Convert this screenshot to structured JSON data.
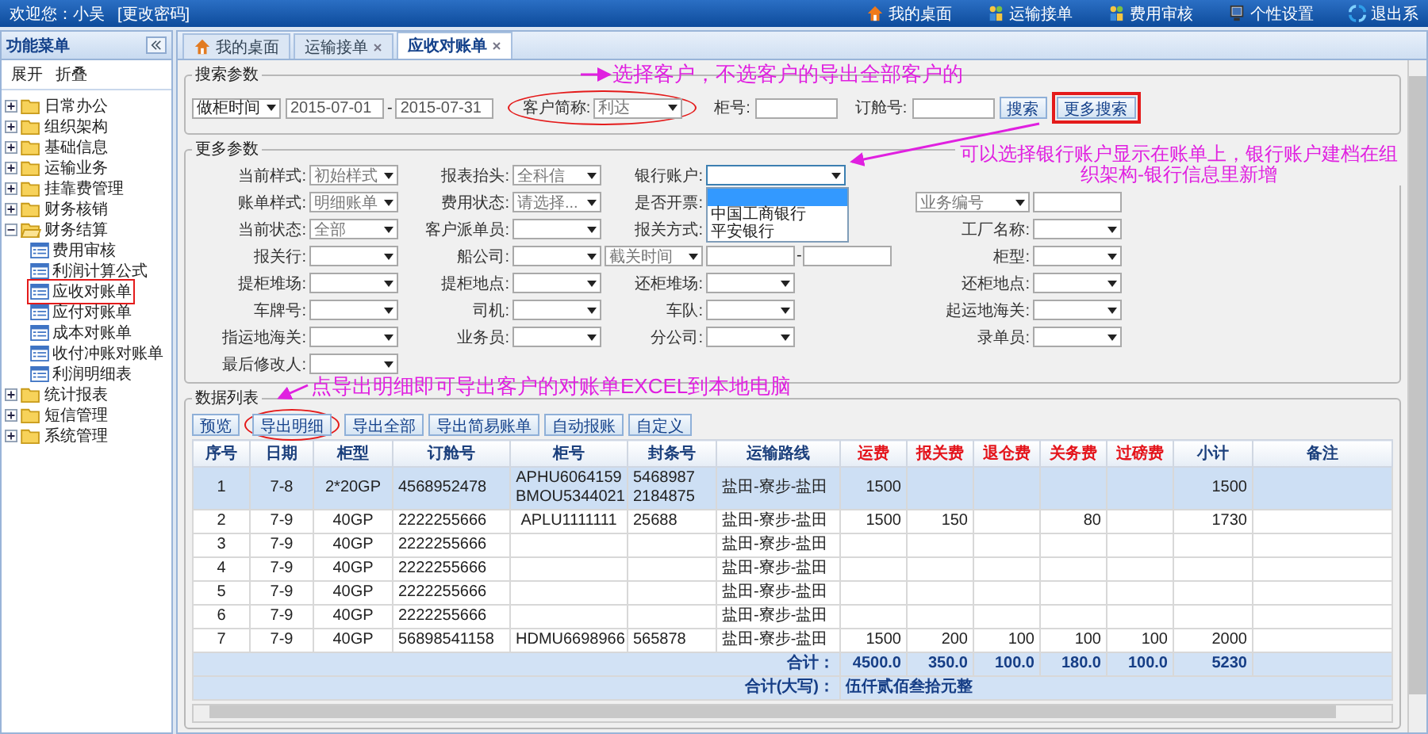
{
  "top_bar": {
    "welcome": "欢迎您：小吴",
    "change_password": "[更改密码]",
    "links": [
      {
        "kind": "home",
        "label": "我的桌面"
      },
      {
        "kind": "people",
        "label": "运输接单"
      },
      {
        "kind": "people",
        "label": "费用审核"
      },
      {
        "kind": "monitor",
        "label": "个性设置"
      },
      {
        "kind": "exit",
        "label": "退出系"
      }
    ]
  },
  "sidebar": {
    "title": "功能菜单",
    "actions": [
      "展开",
      "折叠"
    ],
    "tree": [
      {
        "label": "日常办公",
        "expanded": false
      },
      {
        "label": "组织架构",
        "expanded": false
      },
      {
        "label": "基础信息",
        "expanded": false
      },
      {
        "label": "运输业务",
        "expanded": false
      },
      {
        "label": "挂靠费管理",
        "expanded": false
      },
      {
        "label": "财务核销",
        "expanded": false
      },
      {
        "label": "财务结算",
        "expanded": true,
        "children": [
          {
            "label": "费用审核",
            "circled": false
          },
          {
            "label": "利润计算公式",
            "circled": false
          },
          {
            "label": "应收对账单",
            "circled": true
          },
          {
            "label": "应付对账单",
            "circled": false
          },
          {
            "label": "成本对账单",
            "circled": false
          },
          {
            "label": "收付冲账对账单",
            "circled": false
          },
          {
            "label": "利润明细表",
            "circled": false
          }
        ]
      },
      {
        "label": "统计报表",
        "expanded": false
      },
      {
        "label": "短信管理",
        "expanded": false
      },
      {
        "label": "系统管理",
        "expanded": false
      }
    ]
  },
  "tabs": [
    {
      "label": "我的桌面",
      "kind": "home",
      "closable": false,
      "selected": false
    },
    {
      "label": "运输接单",
      "kind": "plain",
      "closable": true,
      "selected": false
    },
    {
      "label": "应收对账单",
      "kind": "plain",
      "closable": true,
      "selected": true
    }
  ],
  "search": {
    "legend": "搜索参数",
    "date_type": "做柜时间",
    "date_from": "2015-07-01",
    "separator": "-",
    "date_to": "2015-07-31",
    "customer": {
      "label": "客户简称:",
      "value": "利达",
      "circled": true
    },
    "container_label": "柜号:",
    "booking_label": "订舱号:",
    "buttons": [
      {
        "label": "搜索",
        "circled": false
      },
      {
        "label": "更多搜索",
        "circled": true
      }
    ]
  },
  "more": {
    "legend": "更多参数",
    "rows": [
      [
        {
          "kind": "select",
          "label": "当前样式:",
          "value": "初始样式"
        },
        {
          "kind": "select",
          "label": "报表抬头:",
          "value": "全科信"
        },
        {
          "kind": "select_open",
          "label": "银行账户:",
          "options": [
            {
              "selected": true
            },
            {
              "label": "中国工商银行",
              "selected": false
            },
            {
              "label": "平安银行",
              "selected": false
            }
          ]
        }
      ],
      [
        {
          "kind": "select",
          "label": "账单样式:",
          "value": "明细账单"
        },
        {
          "kind": "select",
          "label": "费用状态:",
          "value": "请选择..."
        },
        {
          "kind": "covered",
          "label": "是否开票:"
        },
        {
          "kind": "select_input",
          "value": "业务编号"
        }
      ],
      [
        {
          "kind": "select",
          "label": "当前状态:",
          "value": "全部"
        },
        {
          "kind": "select",
          "label": "客户派单员:"
        },
        {
          "kind": "covered",
          "label": "报关方式:"
        },
        {
          "kind": "select",
          "label": "工厂名称:"
        }
      ],
      [
        {
          "kind": "select",
          "label": "报关行:"
        },
        {
          "kind": "select",
          "label": "船公司:"
        },
        {
          "kind": "select_range",
          "value": "截关时间",
          "separator": "-"
        },
        {
          "kind": "select",
          "label": "柜型:"
        }
      ],
      [
        {
          "kind": "select",
          "label": "提柜堆场:"
        },
        {
          "kind": "select",
          "label": "提柜地点:"
        },
        {
          "kind": "select",
          "label": "还柜堆场:"
        },
        {
          "kind": "select",
          "label": "还柜地点:"
        }
      ],
      [
        {
          "kind": "select",
          "label": "车牌号:"
        },
        {
          "kind": "select",
          "label": "司机:"
        },
        {
          "kind": "select",
          "label": "车队:"
        },
        {
          "kind": "select",
          "label": "起运地海关:"
        }
      ],
      [
        {
          "kind": "select",
          "label": "指运地海关:"
        },
        {
          "kind": "select",
          "label": "业务员:"
        },
        {
          "kind": "select",
          "label": "分公司:"
        },
        {
          "kind": "select",
          "label": "录单员:"
        }
      ],
      [
        {
          "kind": "select",
          "label": "最后修改人:"
        }
      ]
    ]
  },
  "data_list": {
    "legend": "数据列表",
    "toolbar": [
      {
        "label": "预览",
        "circled": false
      },
      {
        "label": "导出明细",
        "circled": true
      },
      {
        "label": "导出全部",
        "circled": false
      },
      {
        "label": "导出简易账单",
        "circled": false
      },
      {
        "label": "自动报账",
        "circled": false
      },
      {
        "label": "自定义",
        "circled": false
      }
    ],
    "columns": [
      {
        "label": "序号",
        "kind": "plain"
      },
      {
        "label": "日期",
        "kind": "plain"
      },
      {
        "label": "柜型",
        "kind": "plain"
      },
      {
        "label": "订舱号",
        "kind": "plain"
      },
      {
        "label": "柜号",
        "kind": "plain"
      },
      {
        "label": "封条号",
        "kind": "plain"
      },
      {
        "label": "运输路线",
        "kind": "plain"
      },
      {
        "label": "运费",
        "kind": "fee"
      },
      {
        "label": "报关费",
        "kind": "fee"
      },
      {
        "label": "退仓费",
        "kind": "fee"
      },
      {
        "label": "关务费",
        "kind": "fee"
      },
      {
        "label": "过磅费",
        "kind": "fee"
      },
      {
        "label": "小计",
        "kind": "plain"
      },
      {
        "label": "备注",
        "kind": "plain"
      }
    ],
    "rows": [
      {
        "selected": true,
        "cells": [
          "1",
          "7-8",
          "2*20GP",
          "4568952478",
          "APHU6064159\nBMOU5344021",
          "5468987\n2184875",
          "盐田-寮步-盐田",
          "1500",
          null,
          null,
          null,
          null,
          "1500",
          null
        ]
      },
      {
        "selected": false,
        "cells": [
          "2",
          "7-9",
          "40GP",
          "2222255666",
          "APLU1111111",
          "25688",
          "盐田-寮步-盐田",
          "1500",
          "150",
          null,
          "80",
          null,
          "1730",
          null
        ]
      },
      {
        "selected": false,
        "cells": [
          "3",
          "7-9",
          "40GP",
          "2222255666",
          null,
          null,
          "盐田-寮步-盐田",
          null,
          null,
          null,
          null,
          null,
          null,
          null
        ]
      },
      {
        "selected": false,
        "cells": [
          "4",
          "7-9",
          "40GP",
          "2222255666",
          null,
          null,
          "盐田-寮步-盐田",
          null,
          null,
          null,
          null,
          null,
          null,
          null
        ]
      },
      {
        "selected": false,
        "cells": [
          "5",
          "7-9",
          "40GP",
          "2222255666",
          null,
          null,
          "盐田-寮步-盐田",
          null,
          null,
          null,
          null,
          null,
          null,
          null
        ]
      },
      {
        "selected": false,
        "cells": [
          "6",
          "7-9",
          "40GP",
          "2222255666",
          null,
          null,
          "盐田-寮步-盐田",
          null,
          null,
          null,
          null,
          null,
          null,
          null
        ]
      },
      {
        "selected": false,
        "cells": [
          "7",
          "7-9",
          "40GP",
          "56898541158",
          "HDMU6698966",
          "565878",
          "盐田-寮步-盐田",
          "1500",
          "200",
          "100",
          "100",
          "100",
          "2000",
          null
        ]
      }
    ],
    "total": {
      "label": "合计：",
      "values": [
        "4500.0",
        "350.0",
        "100.0",
        "180.0",
        "100.0",
        "5230"
      ]
    },
    "total_words": {
      "label": "合计(大写)：",
      "value": "伍仟贰佰叁拾元整"
    }
  },
  "annotations": [
    "选择客户，不选客户的导出全部客户的",
    "可以选择银行账户显示在账单上，银行账户建档在组织架构-银行信息里新增",
    "点导出明细即可导出客户的对账单EXCEL到本地电脑"
  ]
}
